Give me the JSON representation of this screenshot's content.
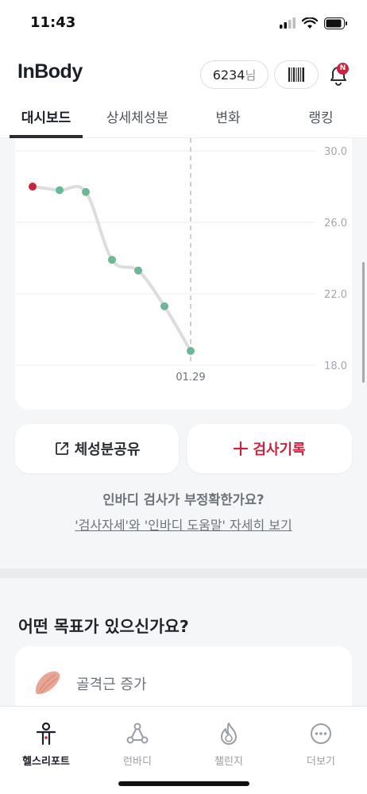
{
  "status_bar": {
    "time": "11:43"
  },
  "header": {
    "logo": "InBody",
    "user_id": "6234",
    "user_suffix": "님",
    "notification_badge": "N"
  },
  "tabs": [
    {
      "label": "대시보드",
      "active": true
    },
    {
      "label": "상세체성분",
      "active": false
    },
    {
      "label": "변화",
      "active": false
    },
    {
      "label": "랭킹",
      "active": false
    }
  ],
  "chart_data": {
    "type": "line",
    "y_ticks": [
      "30.0",
      "26.0",
      "22.0",
      "18.0"
    ],
    "ylim": [
      18.0,
      30.0
    ],
    "values": [
      28.0,
      27.8,
      27.7,
      23.9,
      23.3,
      21.3,
      18.8
    ],
    "selected_label": "01.29",
    "point_colors": [
      "#c8243f",
      "#6bb796",
      "#6bb796",
      "#6bb796",
      "#6bb796",
      "#6bb796",
      "#6bb796"
    ]
  },
  "actions": {
    "share_label": "체성분공유",
    "record_label": "검사기록"
  },
  "help": {
    "question": "인바디 검사가 부정확한가요?",
    "link": "'검사자세'와 '인바디 도움말' 자세히 보기"
  },
  "goals": {
    "title": "어떤 목표가 있으신가요?",
    "first_item": "골격근 증가"
  },
  "bottom_nav": [
    {
      "label": "헬스리포트",
      "icon": "person-icon",
      "active": true
    },
    {
      "label": "런바디",
      "icon": "nodes-icon",
      "active": false
    },
    {
      "label": "챌린지",
      "icon": "flame-icon",
      "active": false
    },
    {
      "label": "더보기",
      "icon": "more-icon",
      "active": false
    }
  ],
  "colors": {
    "accent": "#c8243f",
    "point": "#6bb796",
    "line": "#dcdde0"
  }
}
